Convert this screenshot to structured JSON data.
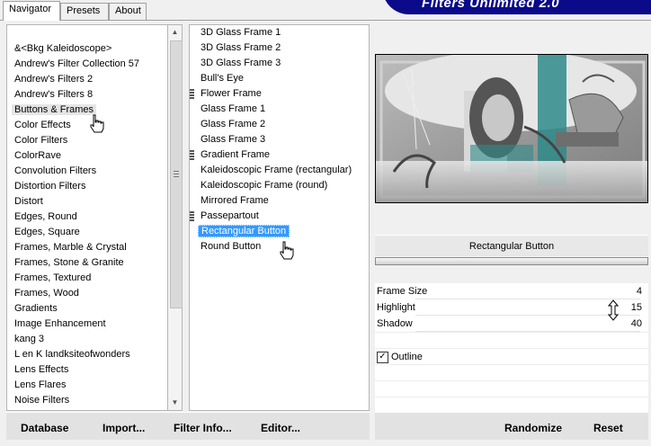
{
  "tabs": [
    {
      "label": "Navigator",
      "active": true
    },
    {
      "label": "Presets",
      "active": false
    },
    {
      "label": "About",
      "active": false
    }
  ],
  "brand": {
    "title": "Filters Unlimited 2.0",
    "color": "#0a0a8a"
  },
  "categories": {
    "items": [
      "&<Bkg Kaleidoscope>",
      "Andrew's Filter Collection 57",
      "Andrew's Filters 2",
      "Andrew's Filters 8",
      "Buttons & Frames",
      "Color Effects",
      "Color Filters",
      "ColorRave",
      "Convolution Filters",
      "Distortion Filters",
      "Distort",
      "Edges, Round",
      "Edges, Square",
      "Frames, Marble & Crystal",
      "Frames, Stone & Granite",
      "Frames, Textured",
      "Frames, Wood",
      "Gradients",
      "Image Enhancement",
      "kang 3",
      "L en K landksiteofwonders",
      "Lens Effects",
      "Lens Flares",
      "Noise Filters"
    ],
    "selected_index": 4
  },
  "filters": {
    "items": [
      {
        "label": "3D Glass Frame 1",
        "grip": false
      },
      {
        "label": "3D Glass Frame 2",
        "grip": false
      },
      {
        "label": "3D Glass Frame 3",
        "grip": false
      },
      {
        "label": "Bull's Eye",
        "grip": false
      },
      {
        "label": "Flower Frame",
        "grip": true
      },
      {
        "label": "Glass Frame 1",
        "grip": false
      },
      {
        "label": "Glass Frame 2",
        "grip": false
      },
      {
        "label": "Glass Frame 3",
        "grip": false
      },
      {
        "label": "Gradient Frame",
        "grip": true
      },
      {
        "label": "Kaleidoscopic Frame (rectangular)",
        "grip": false
      },
      {
        "label": "Kaleidoscopic Frame (round)",
        "grip": false
      },
      {
        "label": "Mirrored Frame",
        "grip": false
      },
      {
        "label": "Passepartout",
        "grip": true
      },
      {
        "label": "Rectangular Button",
        "grip": false
      },
      {
        "label": "Round Button",
        "grip": false
      }
    ],
    "selected_index": 13,
    "highlight_color": "#3399ff"
  },
  "preview": {
    "teal": "#2f8a8a"
  },
  "current_filter": {
    "name": "Rectangular Button"
  },
  "controls": [
    {
      "name": "Frame Size",
      "value": "4"
    },
    {
      "name": "Highlight",
      "value": "15"
    },
    {
      "name": "Shadow",
      "value": "40"
    }
  ],
  "outline": {
    "label": "Outline",
    "checked": true,
    "mark": "✓"
  },
  "bottom_buttons": {
    "database": "Database",
    "import": "Import...",
    "filter_info": "Filter Info...",
    "editor": "Editor...",
    "randomize": "Randomize",
    "reset": "Reset"
  }
}
